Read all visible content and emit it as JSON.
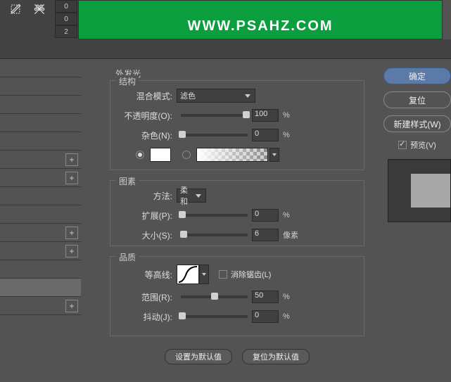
{
  "banner": {
    "text": "WWW.PSAHZ.COM"
  },
  "tool_numbers": [
    "0",
    "0",
    "2"
  ],
  "effect_title": "外发光",
  "structure": {
    "legend": "结构",
    "blend_label": "混合模式:",
    "blend_value": "滤色",
    "opacity_label": "不透明度(O):",
    "opacity_value": "100",
    "noise_label": "杂色(N):",
    "noise_value": "0",
    "percent": "%"
  },
  "elements": {
    "legend": "图素",
    "method_label": "方法:",
    "method_value": "柔和",
    "spread_label": "扩展(P):",
    "spread_value": "0",
    "size_label": "大小(S):",
    "size_value": "6",
    "px": "像素",
    "percent": "%"
  },
  "quality": {
    "legend": "品质",
    "contour_label": "等高线:",
    "anti_alias": "消除锯齿(L)",
    "range_label": "范围(R):",
    "range_value": "50",
    "jitter_label": "抖动(J):",
    "jitter_value": "0",
    "percent": "%"
  },
  "buttons": {
    "set_default": "设置为默认值",
    "reset_default": "复位为默认值",
    "ok": "确定",
    "reset": "复位",
    "new_style": "新建样式(W)",
    "preview": "预览(V)"
  }
}
